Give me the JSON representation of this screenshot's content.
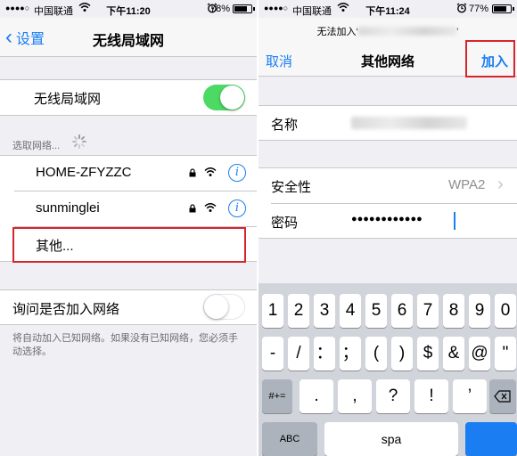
{
  "left_screen": {
    "status": {
      "signal": "●●●●○",
      "carrier": "中国联通",
      "time": "下午11:20",
      "battery_pct": "78%",
      "battery_level": 0.78
    },
    "nav": {
      "back_label": "设置",
      "title": "无线局域网"
    },
    "wifi_row": {
      "label": "无线局域网",
      "toggle_on": true
    },
    "section_header": "选取网络...",
    "networks": [
      {
        "name": "HOME-ZFYZZC"
      },
      {
        "name": "sunminglei"
      }
    ],
    "other_label": "其他...",
    "ask_row": {
      "label": "询问是否加入网络",
      "toggle_on": false
    },
    "footer_note": "将自动加入已知网络。如果没有已知网络，您必须手动选择。"
  },
  "right_screen": {
    "status": {
      "signal": "●●●●○",
      "carrier": "中国联通",
      "time": "下午11:24",
      "battery_pct": "77%",
      "battery_level": 0.77
    },
    "nav": {
      "prompt": "无法加入‘",
      "prompt_end": "’",
      "cancel_label": "取消",
      "title": "其他网络",
      "join_label": "加入"
    },
    "fields": {
      "name_label": "名称",
      "security_label": "安全性",
      "security_value": "WPA2",
      "password_label": "密码",
      "password_value": "●●●●●●●●●●●●"
    },
    "keyboard": {
      "row1": [
        "1",
        "2",
        "3",
        "4",
        "5",
        "6",
        "7",
        "8",
        "9",
        "0"
      ],
      "row2": [
        "-",
        "/",
        "：",
        "；",
        "(",
        ")",
        "$",
        "&",
        "@",
        "\""
      ],
      "row3_mode": "#+=",
      "row3": [
        ".",
        ",",
        "?",
        "!",
        "’"
      ],
      "abc_label": "ABC",
      "space_label": "spa"
    }
  },
  "colors": {
    "accent": "#1a7ef2",
    "toggle_on": "#4cd964",
    "highlight_box": "#d6262d"
  }
}
